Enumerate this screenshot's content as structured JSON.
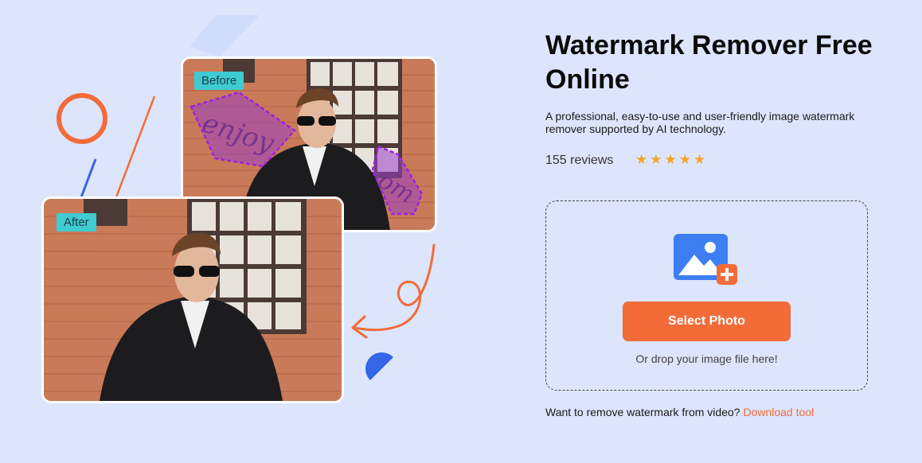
{
  "hero": {
    "title": "Watermark Remover Free Online",
    "description": "A professional, easy-to-use and user-friendly image watermark remover supported by AI technology.",
    "reviews_label": "155 reviews",
    "rating_stars": "★★★★★",
    "rating_value": 5
  },
  "preview": {
    "before_label": "Before",
    "after_label": "After",
    "watermark_text_1": "enjoy",
    "watermark_text_2": "om"
  },
  "upload": {
    "select_label": "Select Photo",
    "drop_hint": "Or drop your image file here!"
  },
  "footer": {
    "video_question": "Want to remove watermark from video?",
    "download_link": "Download tool"
  },
  "colors": {
    "background": "#dce5fc",
    "accent": "#f26c3a",
    "tag": "#3fcbd2",
    "star": "#f7a325",
    "watermark_mask": "#9b3fc9"
  }
}
